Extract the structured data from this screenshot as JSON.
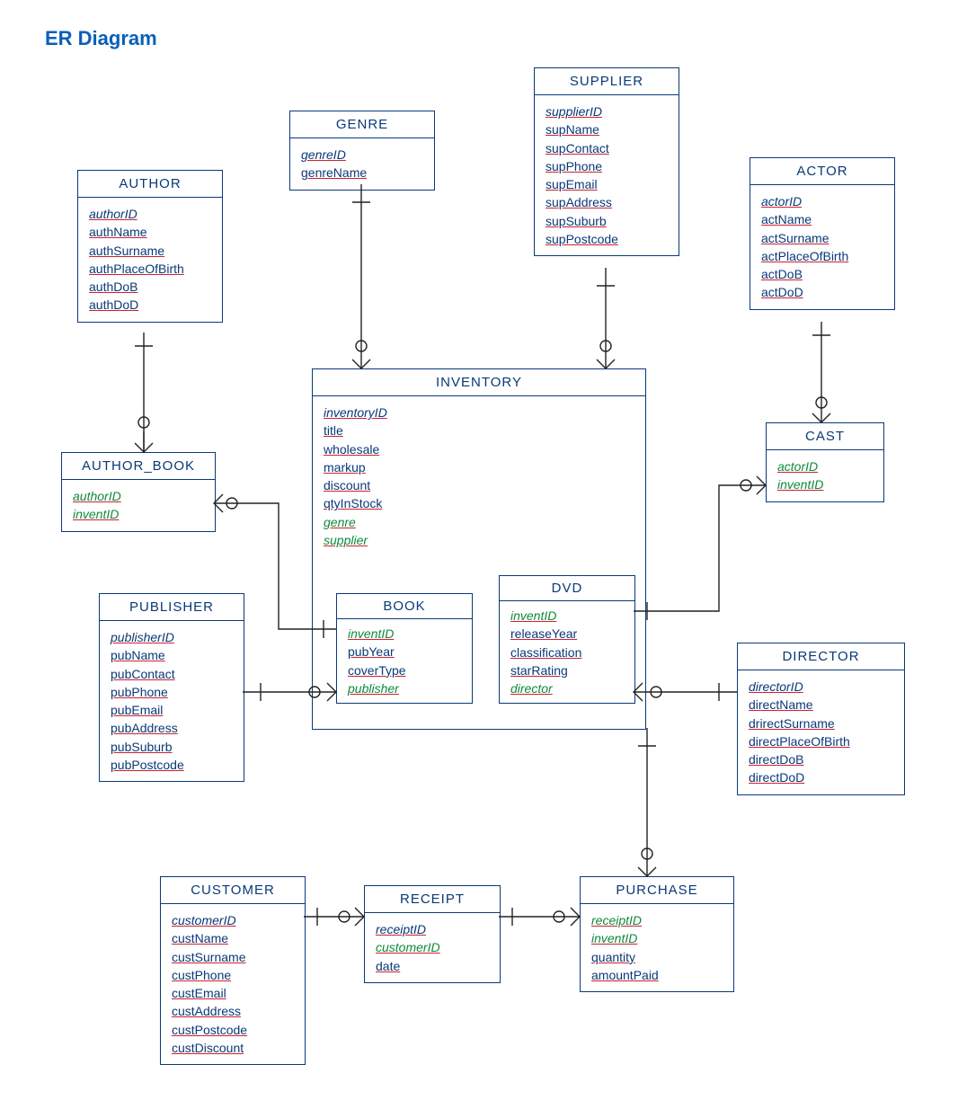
{
  "title": "ER Diagram",
  "entities": {
    "author": {
      "name": "AUTHOR",
      "attrs": [
        "authorID",
        "authName",
        "authSurname",
        "authPlaceOfBirth",
        "authDoB",
        "authDoD"
      ],
      "pk": [
        0
      ]
    },
    "genre": {
      "name": "GENRE",
      "attrs": [
        "genreID",
        "genreName"
      ],
      "pk": [
        0
      ]
    },
    "supplier": {
      "name": "SUPPLIER",
      "attrs": [
        "supplierID",
        "supName",
        "supContact",
        "supPhone",
        "supEmail",
        "supAddress",
        "supSuburb",
        "supPostcode"
      ],
      "pk": [
        0
      ]
    },
    "actor": {
      "name": "ACTOR",
      "attrs": [
        "actorID",
        "actName",
        "actSurname",
        "actPlaceOfBirth",
        "actDoB",
        "actDoD"
      ],
      "pk": [
        0
      ]
    },
    "author_book": {
      "name": "AUTHOR_BOOK",
      "attrs": [
        "authorID",
        "inventID"
      ],
      "pk": [
        0,
        1
      ],
      "fk": [
        0,
        1
      ]
    },
    "inventory": {
      "name": "INVENTORY",
      "attrs": [
        "inventoryID",
        "title",
        "wholesale",
        "markup",
        "discount",
        "qtyInStock",
        "genre",
        "supplier"
      ],
      "pk": [
        0
      ],
      "fk": [
        6,
        7
      ]
    },
    "cast": {
      "name": "CAST",
      "attrs": [
        "actorID",
        "inventID"
      ],
      "pk": [
        0,
        1
      ],
      "fk": [
        0,
        1
      ]
    },
    "publisher": {
      "name": "PUBLISHER",
      "attrs": [
        "publisherID",
        "pubName",
        "pubContact",
        "pubPhone",
        "pubEmail",
        "pubAddress",
        "pubSuburb",
        "pubPostcode"
      ],
      "pk": [
        0
      ]
    },
    "book": {
      "name": "BOOK",
      "attrs": [
        "inventID",
        "pubYear",
        "coverType",
        "publisher"
      ],
      "pk": [
        0
      ],
      "fk": [
        0,
        3
      ]
    },
    "dvd": {
      "name": "DVD",
      "attrs": [
        "inventID",
        "releaseYear",
        "classification",
        "starRating",
        "director"
      ],
      "pk": [
        0
      ],
      "fk": [
        0,
        4
      ]
    },
    "director": {
      "name": "DIRECTOR",
      "attrs": [
        "directorID",
        "directName",
        "drirectSurname",
        "directPlaceOfBirth",
        "directDoB",
        "directDoD"
      ],
      "pk": [
        0
      ]
    },
    "customer": {
      "name": "CUSTOMER",
      "attrs": [
        "customerID",
        "custName",
        "custSurname",
        "custPhone",
        "custEmail",
        "custAddress",
        "custPostcode",
        "custDiscount"
      ],
      "pk": [
        0
      ]
    },
    "receipt": {
      "name": "RECEIPT",
      "attrs": [
        "receiptID",
        "customerID",
        "date"
      ],
      "pk": [
        0
      ],
      "fk": [
        1
      ]
    },
    "purchase": {
      "name": "PURCHASE",
      "attrs": [
        "receiptID",
        "inventID",
        "quantity",
        "amountPaid"
      ],
      "pk": [
        0,
        1
      ],
      "fk": [
        0,
        1
      ]
    }
  },
  "chart_data": {
    "type": "table",
    "title": "ER Diagram",
    "entities": [
      {
        "name": "AUTHOR",
        "pk": [
          "authorID"
        ],
        "attrs": [
          "authorID",
          "authName",
          "authSurname",
          "authPlaceOfBirth",
          "authDoB",
          "authDoD"
        ]
      },
      {
        "name": "GENRE",
        "pk": [
          "genreID"
        ],
        "attrs": [
          "genreID",
          "genreName"
        ]
      },
      {
        "name": "SUPPLIER",
        "pk": [
          "supplierID"
        ],
        "attrs": [
          "supplierID",
          "supName",
          "supContact",
          "supPhone",
          "supEmail",
          "supAddress",
          "supSuburb",
          "supPostcode"
        ]
      },
      {
        "name": "ACTOR",
        "pk": [
          "actorID"
        ],
        "attrs": [
          "actorID",
          "actName",
          "actSurname",
          "actPlaceOfBirth",
          "actDoB",
          "actDoD"
        ]
      },
      {
        "name": "AUTHOR_BOOK",
        "pk": [
          "authorID",
          "inventID"
        ],
        "attrs": [
          "authorID",
          "inventID"
        ]
      },
      {
        "name": "INVENTORY",
        "pk": [
          "inventoryID"
        ],
        "attrs": [
          "inventoryID",
          "title",
          "wholesale",
          "markup",
          "discount",
          "qtyInStock",
          "genre",
          "supplier"
        ]
      },
      {
        "name": "CAST",
        "pk": [
          "actorID",
          "inventID"
        ],
        "attrs": [
          "actorID",
          "inventID"
        ]
      },
      {
        "name": "PUBLISHER",
        "pk": [
          "publisherID"
        ],
        "attrs": [
          "publisherID",
          "pubName",
          "pubContact",
          "pubPhone",
          "pubEmail",
          "pubAddress",
          "pubSuburb",
          "pubPostcode"
        ]
      },
      {
        "name": "BOOK",
        "pk": [
          "inventID"
        ],
        "attrs": [
          "inventID",
          "pubYear",
          "coverType",
          "publisher"
        ]
      },
      {
        "name": "DVD",
        "pk": [
          "inventID"
        ],
        "attrs": [
          "inventID",
          "releaseYear",
          "classification",
          "starRating",
          "director"
        ]
      },
      {
        "name": "DIRECTOR",
        "pk": [
          "directorID"
        ],
        "attrs": [
          "directorID",
          "directName",
          "drirectSurname",
          "directPlaceOfBirth",
          "directDoB",
          "directDoD"
        ]
      },
      {
        "name": "CUSTOMER",
        "pk": [
          "customerID"
        ],
        "attrs": [
          "customerID",
          "custName",
          "custSurname",
          "custPhone",
          "custEmail",
          "custAddress",
          "custPostcode",
          "custDiscount"
        ]
      },
      {
        "name": "RECEIPT",
        "pk": [
          "receiptID"
        ],
        "attrs": [
          "receiptID",
          "customerID",
          "date"
        ]
      },
      {
        "name": "PURCHASE",
        "pk": [
          "receiptID",
          "inventID"
        ],
        "attrs": [
          "receiptID",
          "inventID",
          "quantity",
          "amountPaid"
        ]
      }
    ],
    "relationships": [
      {
        "from": "AUTHOR",
        "to": "AUTHOR_BOOK",
        "card": "1:N"
      },
      {
        "from": "AUTHOR_BOOK",
        "to": "INVENTORY(BOOK)",
        "card": "N:1"
      },
      {
        "from": "GENRE",
        "to": "INVENTORY",
        "card": "1:N"
      },
      {
        "from": "SUPPLIER",
        "to": "INVENTORY",
        "card": "1:N"
      },
      {
        "from": "ACTOR",
        "to": "CAST",
        "card": "1:N"
      },
      {
        "from": "CAST",
        "to": "DVD",
        "card": "N:1"
      },
      {
        "from": "PUBLISHER",
        "to": "BOOK",
        "card": "1:N"
      },
      {
        "from": "DIRECTOR",
        "to": "DVD",
        "card": "1:N"
      },
      {
        "from": "CUSTOMER",
        "to": "RECEIPT",
        "card": "1:N"
      },
      {
        "from": "RECEIPT",
        "to": "PURCHASE",
        "card": "1:N"
      },
      {
        "from": "INVENTORY",
        "to": "PURCHASE",
        "card": "1:N"
      }
    ]
  }
}
